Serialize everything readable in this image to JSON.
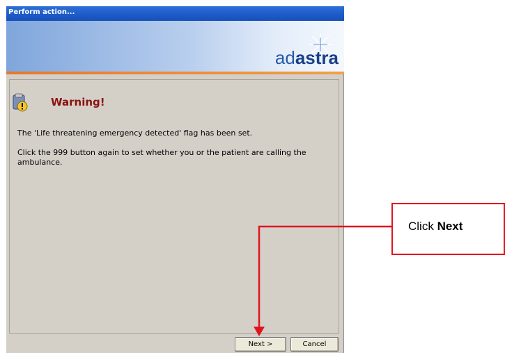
{
  "window": {
    "title": "Perform action..."
  },
  "brand": {
    "logo_prefix": "ad",
    "logo_suffix": "astra"
  },
  "message": {
    "heading": "Warning!",
    "line1": "The 'Life threatening emergency detected' flag has been set.",
    "line2": "Click the 999 button again to set whether you or the patient are calling the ambulance."
  },
  "buttons": {
    "next": "Next >",
    "cancel": "Cancel"
  },
  "annotation": {
    "prefix": "Click ",
    "bold": "Next"
  },
  "colors": {
    "heading": "#8b1212",
    "callout_border": "#e0141f",
    "arrow": "#e0141f",
    "accent_stripe": "#e8782b"
  },
  "icons": [
    "warning-icon",
    "adastra-star-logo"
  ]
}
